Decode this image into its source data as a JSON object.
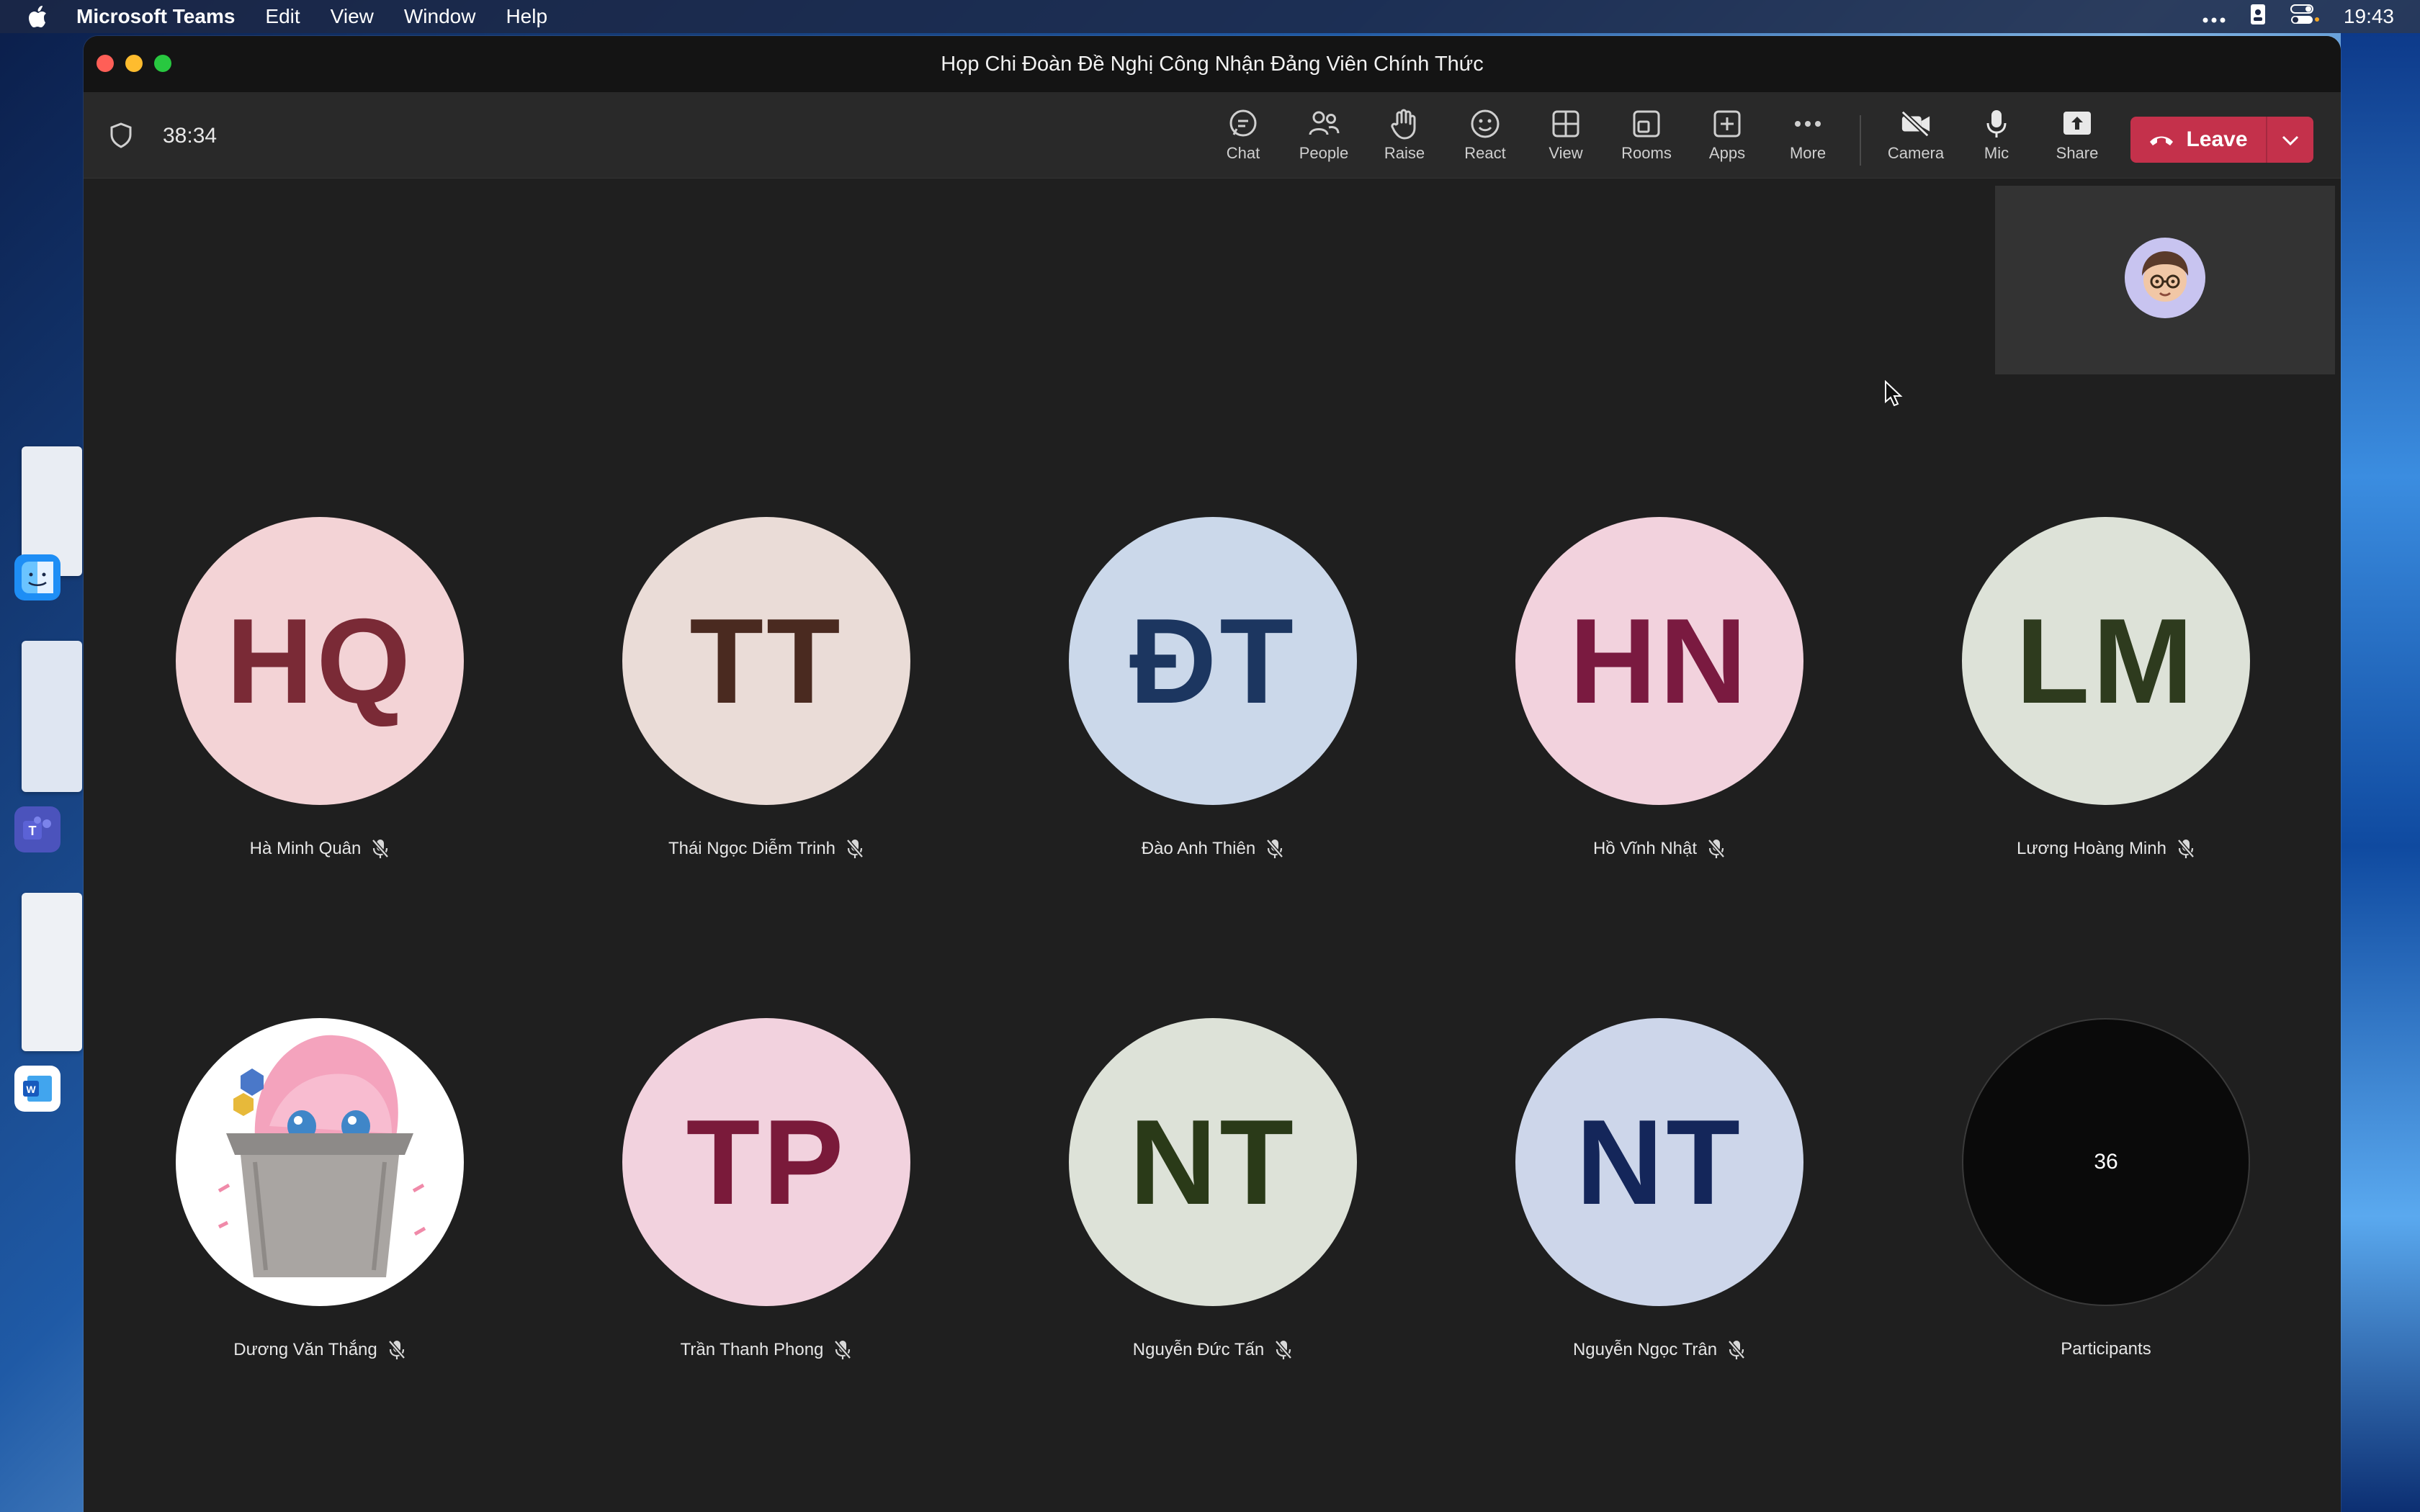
{
  "menubar": {
    "app_name": "Microsoft Teams",
    "items": [
      "Edit",
      "View",
      "Window",
      "Help"
    ],
    "clock": "19:43"
  },
  "window": {
    "title": "Họp Chi Đoàn Đề Nghị Công Nhận Đảng Viên Chính Thức"
  },
  "toolbar": {
    "timer": "38:34",
    "buttons": {
      "chat": "Chat",
      "people": "People",
      "raise": "Raise",
      "react": "React",
      "view": "View",
      "rooms": "Rooms",
      "apps": "Apps",
      "more": "More",
      "camera": "Camera",
      "mic": "Mic",
      "share": "Share"
    },
    "leave_label": "Leave",
    "leave_color": "#c4314b"
  },
  "participants": [
    {
      "initials": "HQ",
      "name": "Hà Minh Quân",
      "bg": "#f3d3d6",
      "fg": "#7a2a36"
    },
    {
      "initials": "TT",
      "name": "Thái Ngọc Diễm Trinh",
      "bg": "#eadcd7",
      "fg": "#4a2a20"
    },
    {
      "initials": "ĐT",
      "name": "Đào Anh Thiên",
      "bg": "#cbd8ea",
      "fg": "#1c3660"
    },
    {
      "initials": "HN",
      "name": "Hồ Vĩnh Nhật",
      "bg": "#f2d2dd",
      "fg": "#7a1a40"
    },
    {
      "initials": "LM",
      "name": "Lương Hoàng Minh",
      "bg": "#dde2d8",
      "fg": "#2e3b1e"
    },
    {
      "initials": "",
      "name": "Dương Văn Thắng",
      "bg": "#ffffff",
      "fg": "#000000",
      "image": "anime-in-trash-bin"
    },
    {
      "initials": "TP",
      "name": "Trần Thanh Phong",
      "bg": "#f2d2de",
      "fg": "#7a1a3a"
    },
    {
      "initials": "NT",
      "name": "Nguyễn Đức Tấn",
      "bg": "#dde2d8",
      "fg": "#2a3a18"
    },
    {
      "initials": "NT",
      "name": "Nguyễn Ngọc Trân",
      "bg": "#cdd6ea",
      "fg": "#14265a"
    }
  ],
  "overflow": {
    "count": "36",
    "label": "Participants"
  },
  "icons": {
    "mic_off": "mic-off-icon",
    "shield": "shield-icon",
    "camera_off": "camera-off-icon"
  }
}
